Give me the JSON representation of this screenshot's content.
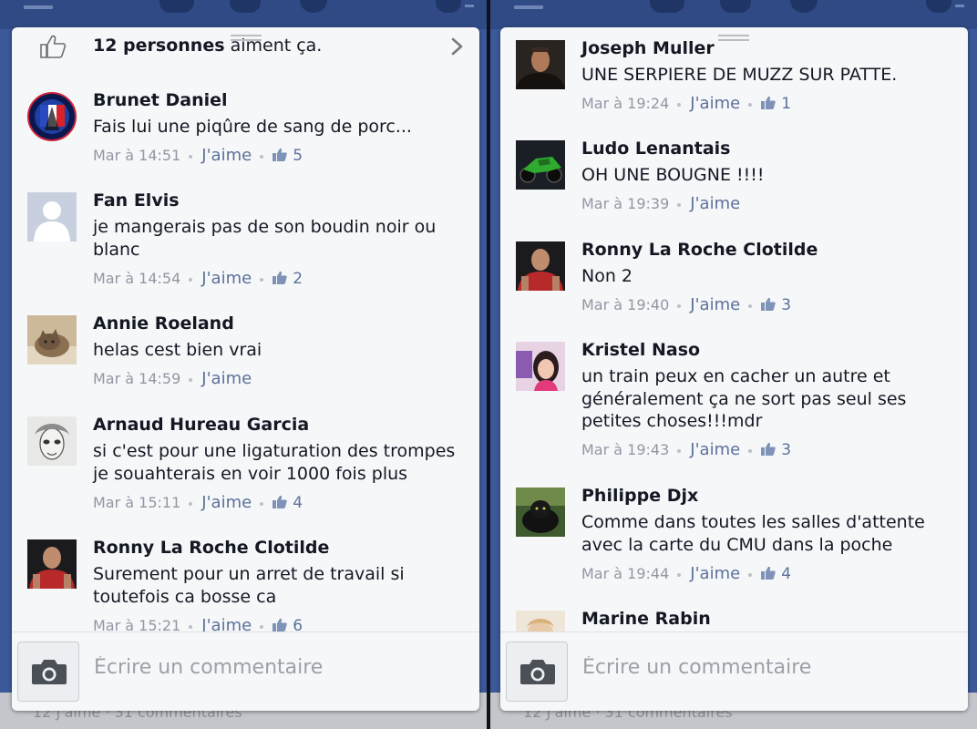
{
  "left": {
    "likes_count": "12 personnes",
    "likes_suffix": " aiment ça.",
    "comments": [
      {
        "name": "Brunet Daniel",
        "text": "Fais lui une piqûre de sang de porc...",
        "time": "Mar à 14:51",
        "like_label": "J'aime",
        "likes": "5"
      },
      {
        "name": "Fan Elvis",
        "text": "je mangerais pas de son boudin noir ou blanc",
        "time": "Mar à 14:54",
        "like_label": "J'aime",
        "likes": "2"
      },
      {
        "name": "Annie Roeland",
        "text": "helas cest bien vrai",
        "time": "Mar à 14:59",
        "like_label": "J'aime",
        "likes": ""
      },
      {
        "name": "Arnaud Hureau Garcia",
        "text": "si c'est pour une ligaturation des trompes je souahterais en voir 1000 fois plus",
        "time": "Mar à 15:11",
        "like_label": "J'aime",
        "likes": "4"
      },
      {
        "name": "Ronny La Roche Clotilde",
        "text": "Surement pour un arret de travail si toutefois ca bosse ca",
        "time": "Mar à 15:21",
        "like_label": "J'aime",
        "likes": "6"
      }
    ],
    "composer_placeholder": "Écrire un commentaire",
    "bottom_text": "12 J'aime · 31 commentaires"
  },
  "right": {
    "comments": [
      {
        "name": "Joseph Muller",
        "text": "UNE SERPIERE DE MUZZ SUR PATTE.",
        "time": "Mar à 19:24",
        "like_label": "J'aime",
        "likes": "1"
      },
      {
        "name": "Ludo Lenantais",
        "text": "OH UNE BOUGNE !!!!",
        "time": "Mar à 19:39",
        "like_label": "J'aime",
        "likes": ""
      },
      {
        "name": "Ronny La Roche Clotilde",
        "text": "Non 2",
        "time": "Mar à 19:40",
        "like_label": "J'aime",
        "likes": "3"
      },
      {
        "name": "Kristel Naso",
        "text": "un train peux en cacher un autre et généralement ça ne sort pas seul ses petites choses!!!mdr",
        "time": "Mar à 19:43",
        "like_label": "J'aime",
        "likes": "3"
      },
      {
        "name": "Philippe Djx",
        "text": "Comme dans toutes les salles d'attente avec la carte du CMU dans la poche",
        "time": "Mar à 19:44",
        "like_label": "J'aime",
        "likes": "4"
      },
      {
        "name": "Marine Rabin",
        "text": "",
        "time": "",
        "like_label": "",
        "likes": ""
      }
    ],
    "composer_placeholder": "Écrire un commentaire",
    "bottom_text": "12 J'aime · 31 commentaires"
  },
  "icons": {
    "likes_row": "thumbs-up-icon",
    "navigate": "chevron-right-icon",
    "camera": "camera-icon",
    "like_count": "mini-thumbs-up-icon"
  },
  "colors": {
    "brand_blue": "#3b5998",
    "topbar_blue": "#2f4a85",
    "link_blue": "#5b7199",
    "meta_gray": "#9197a3",
    "card_bg": "#f6f7f9"
  }
}
